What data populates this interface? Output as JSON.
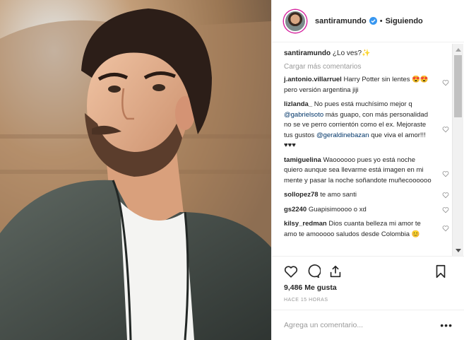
{
  "header": {
    "username": "santiramundo",
    "separator": "•",
    "follow_status": "Siguiendo"
  },
  "caption": {
    "username": "santiramundo",
    "text": "¿Lo ves?✨"
  },
  "load_more": "Cargar más comentarios",
  "comments": [
    {
      "username": "j.antonio.villarruel",
      "text": "Harry Potter sin lentes 😍😍 pero versión argentina jiji"
    },
    {
      "username": "lizlanda_",
      "text_a": "No pues está muchísimo mejor q",
      "mention_a": "@gabrielsoto",
      "text_b": "más guapo, con más personalidad no se ve perro corrientón como el ex. Mejoraste tus gustos",
      "mention_b": "@geraldinebazan",
      "text_c": "que viva el amor!!! ♥♥♥"
    },
    {
      "username": "tamiguelina",
      "text": "Waoooooo pues yo está noche quiero aunque sea llevarme está imagen en mi mente y pasar la noche soñandote muñecoooooo"
    },
    {
      "username": "sollopez78",
      "text": "te amo santi"
    },
    {
      "username": "gs2240",
      "text": "Guapisimoooo o xd"
    },
    {
      "username": "kilsy_redman",
      "text": "Dios cuanta belleza mi amor te amo te amooooo saludos desde Colombia 😊"
    }
  ],
  "likes": "9,486 Me gusta",
  "timestamp": "HACE 15 HORAS",
  "add_comment": {
    "placeholder": "Agrega un comentario..."
  },
  "more_options": "•••",
  "icons": {
    "like": "heart-icon",
    "comment": "comment-icon",
    "share": "share-icon",
    "save": "bookmark-icon",
    "verified": "verified-badge-icon"
  },
  "colors": {
    "text": "#262626",
    "muted": "#999999",
    "verified": "#3897f0",
    "mention": "#003569"
  }
}
